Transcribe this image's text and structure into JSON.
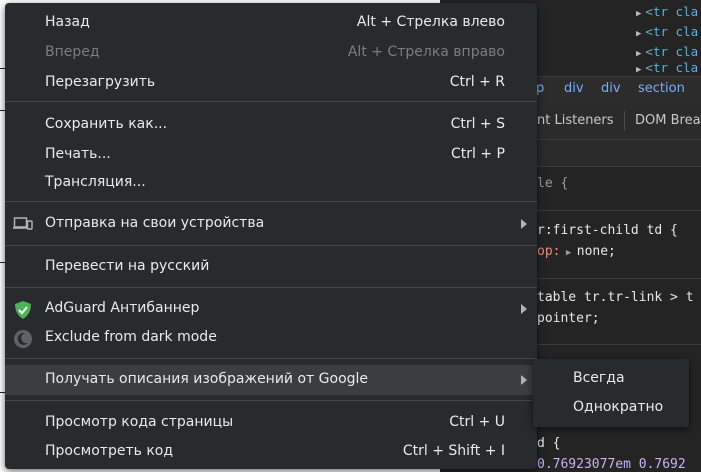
{
  "menu": {
    "items": [
      {
        "label": "Назад",
        "shortcut": "Alt + Стрелка влево"
      },
      {
        "label": "Вперед",
        "shortcut": "Alt + Стрелка вправо",
        "disabled": true
      },
      {
        "label": "Перезагрузить",
        "shortcut": "Ctrl + R"
      },
      {
        "label": "Сохранить как...",
        "shortcut": "Ctrl + S"
      },
      {
        "label": "Печать...",
        "shortcut": "Ctrl + P"
      },
      {
        "label": "Трансляция..."
      },
      {
        "label": "Отправка на свои устройства",
        "icon": "devices-icon",
        "submenu": true
      },
      {
        "label": "Перевести на русский"
      },
      {
        "label": "AdGuard Антибаннер",
        "icon": "adguard-shield-icon",
        "submenu": true
      },
      {
        "label": "Exclude from dark mode",
        "icon": "dark-mode-moon-icon"
      },
      {
        "label": "Получать описания изображений от Google",
        "submenu": true,
        "highlighted": true
      },
      {
        "label": "Просмотр кода страницы",
        "shortcut": "Ctrl + U"
      },
      {
        "label": "Просмотреть код",
        "shortcut": "Ctrl + Shift + I"
      }
    ]
  },
  "submenu": {
    "items": [
      {
        "label": "Всегда"
      },
      {
        "label": "Однократно"
      }
    ]
  },
  "devtools": {
    "dom_lines": [
      "<tr cla",
      "<tr cla",
      "<tr cla",
      "<tr cla"
    ],
    "breadcrumbs": [
      "p",
      "div",
      "div",
      "section"
    ],
    "tabs": [
      "nt Listeners",
      "DOM Brea"
    ],
    "styles": {
      "line1": "le {",
      "line2_sel": "r:first-child td {",
      "line3_prop": "op:",
      "line3_val": "none;",
      "line4": "table tr.tr-link > t",
      "line5": "pointer;",
      "line6": "d {",
      "line7": "0.76923077em 0.7692"
    }
  },
  "colors": {
    "menu_bg": "#292a2d",
    "highlight_bg": "#3c3d41",
    "adguard_green": "#4bb356",
    "link_blue": "#7cacf8"
  }
}
